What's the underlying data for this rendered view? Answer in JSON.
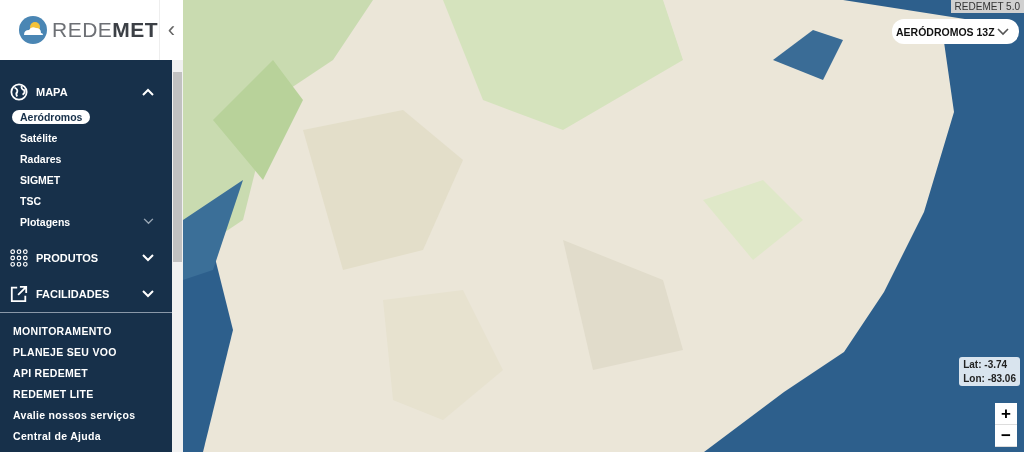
{
  "logo": {
    "text_light": "REDE",
    "text_bold": "MET"
  },
  "collapse_button": {
    "label": "‹"
  },
  "menu": [
    {
      "label": "MAPA",
      "kind": "globe",
      "expanded": true,
      "children": [
        {
          "label": "Aeródromos",
          "selected": true
        },
        {
          "label": "Satélite",
          "selected": false
        },
        {
          "label": "Radares",
          "selected": false
        },
        {
          "label": "SIGMET",
          "selected": false
        },
        {
          "label": "TSC",
          "selected": false
        },
        {
          "label": "Plotagens",
          "selected": false,
          "expandable": true
        }
      ]
    },
    {
      "label": "PRODUTOS",
      "kind": "grid",
      "expanded": false
    },
    {
      "label": "FACILIDADES",
      "kind": "external",
      "expanded": false
    }
  ],
  "links": [
    "MONITORAMENTO",
    "PLANEJE SEU VOO",
    "API REDEMET",
    "REDEMET LITE",
    "Avalie nossos serviços",
    "Central de Ajuda"
  ],
  "map": {
    "kind": "picture",
    "version": "REDEMET 5.0",
    "layer_select": "AERÓDROMOS 13Z",
    "lat": "Lat: -3.74",
    "lon": "Lon: -83.06",
    "zoom_in": "+",
    "zoom_out": "−"
  }
}
